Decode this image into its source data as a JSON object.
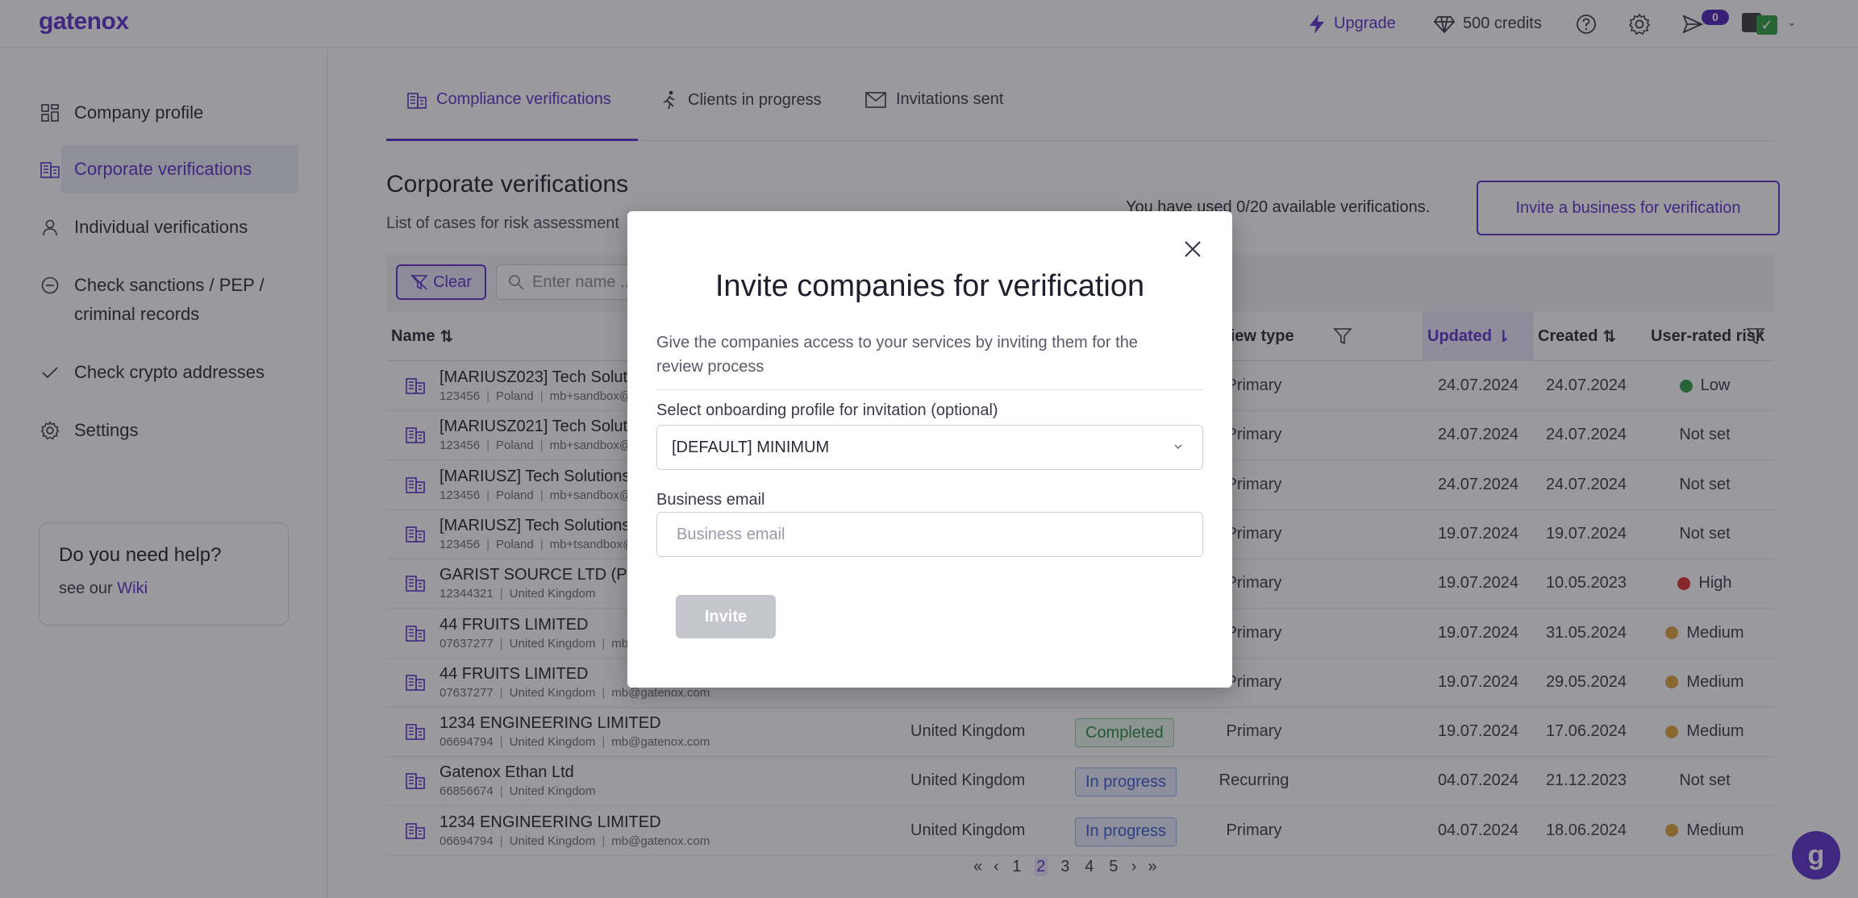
{
  "app": {
    "logo": "gatenox"
  },
  "topbar": {
    "upgrade": "Upgrade",
    "credits": "500 credits",
    "notifications": "0",
    "icons": [
      "lightning-icon",
      "diamond-icon",
      "help-icon",
      "gear-icon",
      "send-icon"
    ]
  },
  "sidebar": {
    "items": [
      {
        "label": "Company profile",
        "icon": "grid-icon"
      },
      {
        "label": "Corporate verifications",
        "icon": "building-icon",
        "active": true
      },
      {
        "label": "Individual verifications",
        "icon": "user-icon"
      },
      {
        "label": "Check sanctions / PEP /",
        "label2": "criminal records",
        "icon": "minus-circle-icon"
      },
      {
        "label": "Check crypto addresses",
        "icon": "check-icon"
      },
      {
        "label": "Settings",
        "icon": "gear-icon"
      }
    ],
    "help": {
      "title": "Do you need help?",
      "prefix": "see our ",
      "link": "Wiki"
    }
  },
  "tabs": [
    {
      "label": "Compliance verifications",
      "active": true
    },
    {
      "label": "Clients in progress"
    },
    {
      "label": "Invitations sent"
    }
  ],
  "page": {
    "title": "Corporate verifications",
    "subtitle": "List of cases for risk assessment",
    "usage": "You have used 0/20 available verifications.",
    "invite_button": "Invite a business for verification"
  },
  "filters": {
    "clear": "Clear",
    "search_placeholder": "Enter name ..."
  },
  "table": {
    "headers": {
      "name": "Name",
      "review_type": "Review type",
      "updated": "Updated",
      "created": "Created",
      "risk": "User-rated risk"
    },
    "rows": [
      {
        "name": "[MARIUSZ023] Tech Solutions",
        "reg": "123456",
        "country": "Poland",
        "email": "mb+sandbox@gatenox.com",
        "status": "",
        "type": "Primary",
        "updated": "24.07.2024",
        "created": "24.07.2024",
        "risk": "Low"
      },
      {
        "name": "[MARIUSZ021] Tech Solutions",
        "reg": "123456",
        "country": "Poland",
        "email": "mb+sandbox@gatenox.com",
        "status": "",
        "type": "Primary",
        "updated": "24.07.2024",
        "created": "24.07.2024",
        "risk": "Not set"
      },
      {
        "name": "[MARIUSZ] Tech Solutions",
        "reg": "123456",
        "country": "Poland",
        "email": "mb+sandbox@gatenox.com",
        "status": "",
        "type": "Primary",
        "updated": "24.07.2024",
        "created": "24.07.2024",
        "risk": "Not set"
      },
      {
        "name": "[MARIUSZ] Tech Solutions",
        "reg": "123456",
        "country": "Poland",
        "email": "mb+tsandbox@gatenox.com",
        "status": "",
        "type": "Primary",
        "updated": "19.07.2024",
        "created": "19.07.2024",
        "risk": "Not set"
      },
      {
        "name": "GARIST SOURCE LTD (PE",
        "reg": "12344321",
        "country": "United Kingdom",
        "email": "",
        "status": "",
        "type": "Primary",
        "updated": "19.07.2024",
        "created": "10.05.2023",
        "risk": "High"
      },
      {
        "name": "44 FRUITS LIMITED",
        "reg": "07637277",
        "country": "United Kingdom",
        "email": "mb@gatenox.com",
        "status": "",
        "type": "Primary",
        "updated": "19.07.2024",
        "created": "31.05.2024",
        "risk": "Medium"
      },
      {
        "name": "44 FRUITS LIMITED",
        "reg": "07637277",
        "country": "United Kingdom",
        "email": "mb@gatenox.com",
        "status": "",
        "type": "Primary",
        "updated": "19.07.2024",
        "created": "29.05.2024",
        "risk": "Medium"
      },
      {
        "name": "1234 ENGINEERING LIMITED",
        "reg": "06694794",
        "country": "United Kingdom",
        "email": "mb@gatenox.com",
        "row_country": "United Kingdom",
        "status": "Completed",
        "type": "Primary",
        "updated": "19.07.2024",
        "created": "17.06.2024",
        "risk": "Medium"
      },
      {
        "name": "Gatenox Ethan Ltd",
        "reg": "66856674",
        "country": "United Kingdom",
        "email": "",
        "row_country": "United Kingdom",
        "status": "In progress",
        "type": "Recurring",
        "updated": "04.07.2024",
        "created": "21.12.2023",
        "risk": "Not set"
      },
      {
        "name": "1234 ENGINEERING LIMITED",
        "reg": "06694794",
        "country": "United Kingdom",
        "email": "mb@gatenox.com",
        "row_country": "United Kingdom",
        "status": "In progress",
        "type": "Primary",
        "updated": "04.07.2024",
        "created": "18.06.2024",
        "risk": "Medium"
      }
    ]
  },
  "risk_colors": {
    "Low": "#2f9e44",
    "High": "#e03131",
    "Medium": "#e0a23a"
  },
  "pagination": {
    "pages": [
      "1",
      "2",
      "3",
      "4",
      "5"
    ],
    "current": "2"
  },
  "modal": {
    "title": "Invite companies for verification",
    "description": "Give the companies access to your services by inviting them for the review process",
    "profile_label": "Select onboarding profile for invitation (optional)",
    "profile_value": "[DEFAULT] MINIMUM",
    "email_label": "Business email",
    "email_placeholder": "Business email",
    "email_value": "",
    "invite_button": "Invite"
  },
  "colors": {
    "accent": "#5b2fc9",
    "completed": "#2b8a3e",
    "in_progress": "#3b5bcc"
  }
}
